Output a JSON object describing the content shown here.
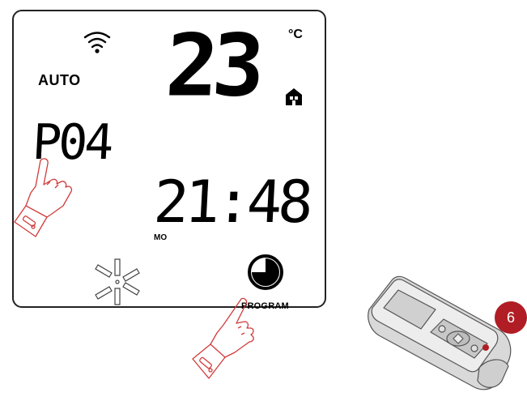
{
  "display": {
    "temperature": "23",
    "temperature_unit": "°C",
    "mode": "AUTO",
    "program": "P04",
    "time": "21:48",
    "day": "MO",
    "program_label": "PROGRAM"
  },
  "icons": {
    "wifi": "wifi-icon",
    "home": "home-icon",
    "snowflake": "snowflake-icon",
    "clock": "clock-icon",
    "hand_pointer": "hand-pointer-icon",
    "remote": "remote-control"
  },
  "badge": {
    "number": "6",
    "color": "#b11d24"
  },
  "colors": {
    "pointer": "#d23a3a"
  }
}
